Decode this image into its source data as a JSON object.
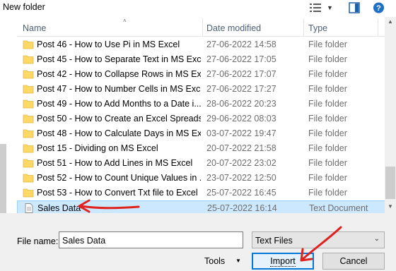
{
  "toolbar": {
    "new_folder_label": "New folder"
  },
  "columns": {
    "name": "Name",
    "date_modified": "Date modified",
    "type": "Type"
  },
  "files": [
    {
      "name": "Post 46 - How to Use Pi in MS Excel",
      "date": "27-06-2022 14:58",
      "type": "File folder",
      "icon": "folder-icon"
    },
    {
      "name": "Post 45 - How to Separate Text in MS Excel",
      "date": "27-06-2022 17:05",
      "type": "File folder",
      "icon": "folder-icon"
    },
    {
      "name": "Post 42 - How to Collapse Rows in MS Ex...",
      "date": "27-06-2022 17:07",
      "type": "File folder",
      "icon": "folder-icon"
    },
    {
      "name": "Post 47 - How to Number Cells in MS Excel",
      "date": "27-06-2022 17:27",
      "type": "File folder",
      "icon": "folder-icon"
    },
    {
      "name": "Post 49 - How to Add Months to a Date i...",
      "date": "28-06-2022 20:23",
      "type": "File folder",
      "icon": "folder-icon"
    },
    {
      "name": "Post 50 - How to Create an Excel Spreads...",
      "date": "29-06-2022 08:03",
      "type": "File folder",
      "icon": "folder-icon"
    },
    {
      "name": "Post 48 - How to Calculate Days in MS Ex...",
      "date": "03-07-2022 19:47",
      "type": "File folder",
      "icon": "folder-icon"
    },
    {
      "name": "Post 15 - Dividing on MS Excel",
      "date": "20-07-2022 21:58",
      "type": "File folder",
      "icon": "folder-icon"
    },
    {
      "name": "Post 51 - How to Add Lines in MS Excel",
      "date": "20-07-2022 23:02",
      "type": "File folder",
      "icon": "folder-icon"
    },
    {
      "name": "Post 52 - How to Count Unique Values in ...",
      "date": "23-07-2022 12:50",
      "type": "File folder",
      "icon": "folder-icon"
    },
    {
      "name": "Post 53 - How to Convert Txt file to Excel ...",
      "date": "25-07-2022 16:45",
      "type": "File folder",
      "icon": "folder-icon"
    },
    {
      "name": "Sales Data",
      "date": "25-07-2022 16:14",
      "type": "Text Document",
      "icon": "text-document-icon",
      "selected": true
    }
  ],
  "bottom": {
    "file_name_label": "File name:",
    "file_name_value": "Sales Data",
    "file_type_value": "Text Files",
    "tools_label": "Tools",
    "import_label": "Import",
    "cancel_label": "Cancel"
  },
  "colors": {
    "selection": "#cce8ff",
    "accent": "#0078d7",
    "folder": "#ffd866",
    "annotation": "#e0211d"
  }
}
